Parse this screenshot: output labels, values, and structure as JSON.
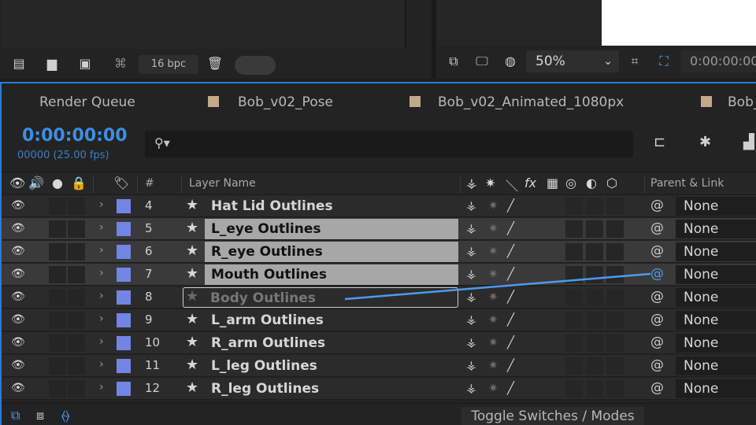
{
  "project_toolbar": {
    "bpc_label": "16 bpc",
    "icons": [
      "render-queue-icon",
      "folder-icon",
      "composition-icon",
      "flowchart-icon",
      "trash-icon"
    ]
  },
  "viewer_toolbar": {
    "zoom": "50%",
    "timecode": "0:00:00:00",
    "icons": [
      "snapshot-icon",
      "monitor-icon",
      "mask-view-icon",
      "grid-icon",
      "region-icon"
    ]
  },
  "timeline": {
    "tabs": [
      {
        "label": "Render Queue",
        "swatch": null
      },
      {
        "label": "Bob_v02_Pose",
        "swatch": "#c2a98a"
      },
      {
        "label": "Bob_v02_Animated_1080px",
        "swatch": "#c2a98a"
      },
      {
        "label": "Bob_",
        "swatch": "#c2a98a"
      }
    ],
    "current_time": "0:00:00:00",
    "frame_info": "00000 (25.00 fps)",
    "search_placeholder": "",
    "columns": {
      "number": "#",
      "layer_name": "Layer Name",
      "parent_link": "Parent & Link"
    },
    "layers": [
      {
        "num": "4",
        "name": "Hat Lid Outlines",
        "parent": "None",
        "state": "normal"
      },
      {
        "num": "5",
        "name": "L_eye Outlines",
        "parent": "None",
        "state": "selected"
      },
      {
        "num": "6",
        "name": "R_eye Outlines",
        "parent": "None",
        "state": "selected"
      },
      {
        "num": "7",
        "name": "Mouth Outlines",
        "parent": "None",
        "state": "selected"
      },
      {
        "num": "8",
        "name": "Body Outlines",
        "parent": "None",
        "state": "drop-target"
      },
      {
        "num": "9",
        "name": "L_arm Outlines",
        "parent": "None",
        "state": "normal"
      },
      {
        "num": "10",
        "name": "R_arm Outlines",
        "parent": "None",
        "state": "normal"
      },
      {
        "num": "11",
        "name": "L_leg Outlines",
        "parent": "None",
        "state": "normal"
      },
      {
        "num": "12",
        "name": "R_leg Outlines",
        "parent": "None",
        "state": "normal"
      }
    ],
    "label_color": "#7186e4",
    "footer": {
      "toggle_label": "Toggle Switches / Modes"
    }
  },
  "colors": {
    "accent": "#2d7ad6",
    "timecode": "#3b8fe4",
    "pickwhip": "#4a9cf0"
  }
}
